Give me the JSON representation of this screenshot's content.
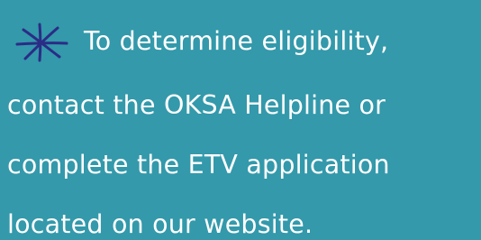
{
  "colors": {
    "background": "#3399ab",
    "text": "#ffffff",
    "star": "#2b2c86"
  },
  "icon": "asterisk-star-icon",
  "message": {
    "line1": "To determine eligibility,",
    "line2": "contact the OKSA Helpline or",
    "line3": "complete the ETV application",
    "line4": "located on our website."
  }
}
